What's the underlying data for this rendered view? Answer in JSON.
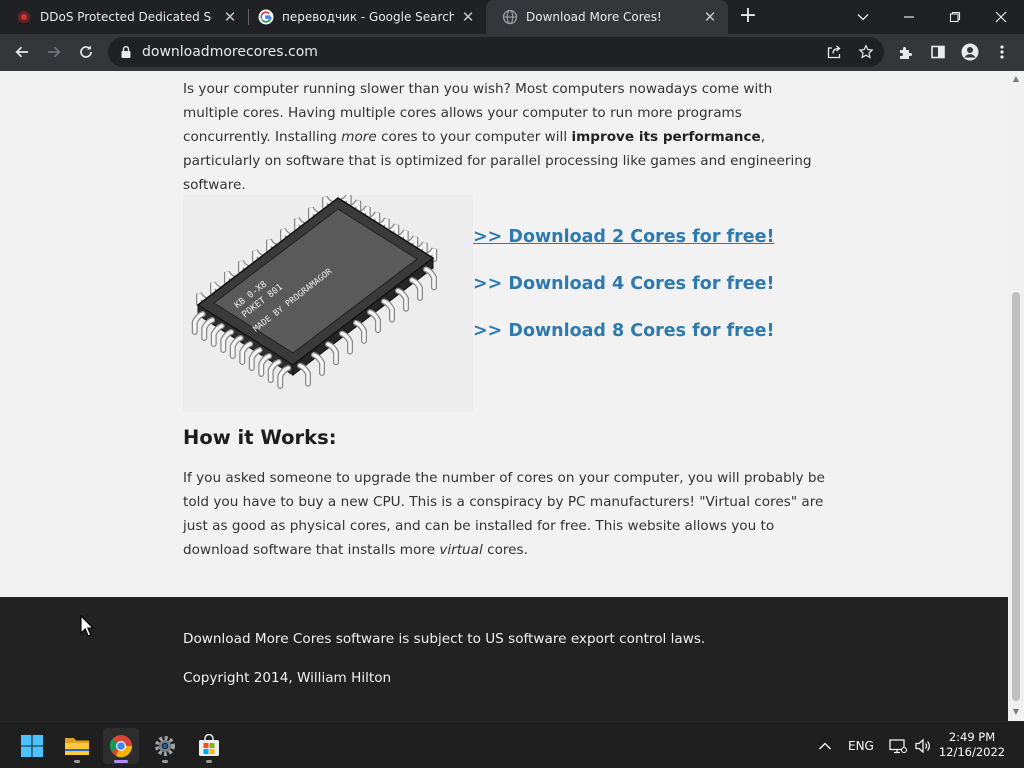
{
  "browser": {
    "tabs": [
      {
        "title": "DDoS Protected Dedicated Serve",
        "favicon": "ddos-shield-icon",
        "active": false
      },
      {
        "title": "переводчик - Google Search",
        "favicon": "google-g-icon",
        "active": false
      },
      {
        "title": "Download More Cores!",
        "favicon": "globe-icon",
        "active": true
      }
    ],
    "url": "downloadmorecores.com"
  },
  "page": {
    "intro": {
      "part1": "Is your computer running slower than you wish? Most computers nowadays come with multiple cores. Having multiple cores allows your computer to run more programs concurrently. Installing ",
      "more": "more",
      "part2": " cores to your computer will ",
      "bold": "improve its performance",
      "part3": ", particularly on software that is optimized for parallel processing like games and engineering software."
    },
    "chip_labels": {
      "line1": "KB 0-X8",
      "line2": "POKET 801",
      "line3": "MADE BY PROGRAMAGOR"
    },
    "download_links": [
      {
        "label": ">> Download 2 Cores for free!",
        "hovered": true
      },
      {
        "label": ">> Download 4 Cores for free!",
        "hovered": false
      },
      {
        "label": ">> Download 8 Cores for free!",
        "hovered": false
      }
    ],
    "how_heading": "How it Works:",
    "how": {
      "part1": "If you asked someone to upgrade the number of cores on your computer, you will probably be told you have to buy a new CPU. This is a conspiracy by PC manufacturers! \"Virtual cores\" are just as good as physical cores, and can be installed for free. This website allows you to download software that installs more ",
      "virtual": "virtual",
      "part2": " cores."
    },
    "footer": {
      "notice": "Download More Cores software is subject to US software export control laws.",
      "copyright": "Copyright 2014, William Hilton"
    }
  },
  "taskbar": {
    "apps": [
      "windows-start-icon",
      "file-explorer-icon",
      "chrome-icon",
      "settings-gear-icon",
      "microsoft-store-icon"
    ],
    "language": "ENG",
    "time": "2:49 PM",
    "date": "12/16/2022"
  },
  "colors": {
    "link": "#2c7ab0",
    "page_bg": "#f2f2f2",
    "footer_bg": "#222222",
    "chrome_bg": "#202124",
    "toolbar_bg": "#35363a"
  }
}
